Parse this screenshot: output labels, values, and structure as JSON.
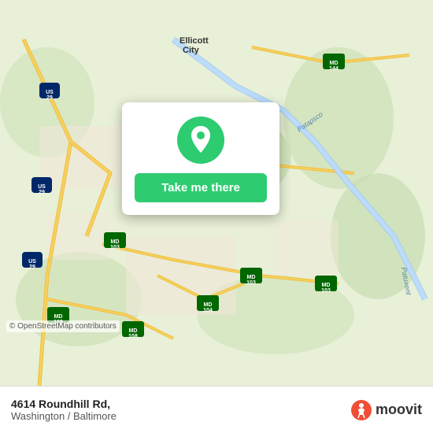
{
  "map": {
    "background_color": "#e8f0d8",
    "copyright": "© OpenStreetMap contributors"
  },
  "card": {
    "button_label": "Take me there",
    "icon": "location-pin-icon"
  },
  "bottom_bar": {
    "address": "4614 Roundhill Rd,",
    "city": "Washington / Baltimore",
    "logo_text": "moovit"
  }
}
